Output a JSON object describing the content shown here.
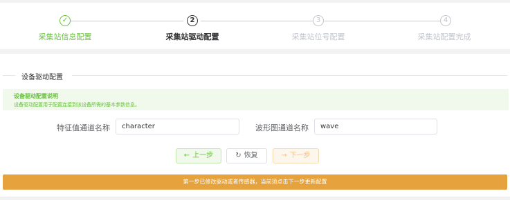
{
  "steps": [
    {
      "number": "✓",
      "title": "采集站信息配置",
      "status": "done"
    },
    {
      "number": "2",
      "title": "采集站驱动配置",
      "status": "active"
    },
    {
      "number": "3",
      "title": "采集站位号配置",
      "status": "wait"
    },
    {
      "number": "4",
      "title": "采集站配置完成",
      "status": "wait"
    }
  ],
  "section": {
    "title": "设备驱动配置"
  },
  "info": {
    "title": "设备驱动配置说明",
    "desc": "设备驱动配置用于配置连接到该设备所需的基本参数信息。"
  },
  "form": {
    "feature_label": "特征值通道名称",
    "feature_value": "character",
    "wave_label": "波形图通道名称",
    "wave_value": "wave"
  },
  "buttons": {
    "prev_icon": "←",
    "prev_label": "上一步",
    "reset_icon": "↻",
    "reset_label": "恢复",
    "next_icon": "→",
    "next_label": "下一步"
  },
  "warning": {
    "text": "第一步已修改驱动或者传感器，当前须点击下一步更新配置"
  },
  "colors": {
    "success": "#67c23a",
    "warning": "#e6a23c",
    "text": "#303133",
    "muted": "#c0c4cc"
  }
}
